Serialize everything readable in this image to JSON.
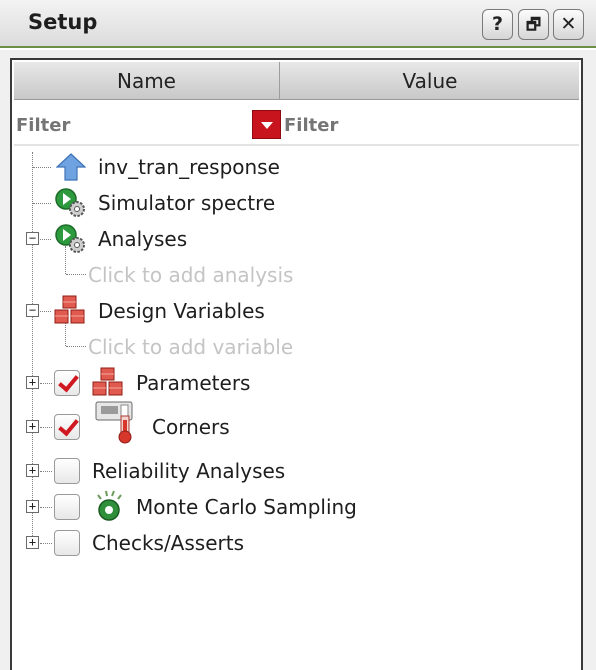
{
  "window": {
    "title": "Setup",
    "buttons": {
      "help": "?",
      "float": "🗗",
      "close": "✕"
    }
  },
  "table": {
    "columns": [
      "Name",
      "Value"
    ],
    "filter_placeholders": {
      "name": "Filter",
      "value": "Filter"
    }
  },
  "tree": [
    {
      "label": "inv_tran_response",
      "icon": "up-arrow-icon",
      "expander": null,
      "checkbox": null
    },
    {
      "label": "Simulator  spectre",
      "icon": "simulator-gear-icon",
      "expander": null,
      "checkbox": null
    },
    {
      "label": "Analyses",
      "icon": "simulator-gear-icon",
      "expander": "collapse",
      "checkbox": null
    },
    {
      "label": "Click to add analysis",
      "hint": true
    },
    {
      "label": "Design Variables",
      "icon": "cubes-icon",
      "expander": "collapse",
      "checkbox": null
    },
    {
      "label": "Click to add variable",
      "hint": true
    },
    {
      "label": "Parameters",
      "icon": "cubes-icon",
      "expander": "expand",
      "checkbox": true
    },
    {
      "label": "Corners",
      "icon": "thermometer-icon",
      "expander": "expand",
      "checkbox": true
    },
    {
      "label": "Reliability Analyses",
      "icon": null,
      "expander": "expand",
      "checkbox": false
    },
    {
      "label": "Monte Carlo Sampling",
      "icon": "dice-icon",
      "expander": "expand",
      "checkbox": false
    },
    {
      "label": "Checks/Asserts",
      "icon": null,
      "expander": "expand",
      "checkbox": false
    }
  ],
  "colors": {
    "accent_green": "#6e8f47",
    "check_red": "#d01820",
    "dropdown_red": "#c8141c"
  }
}
